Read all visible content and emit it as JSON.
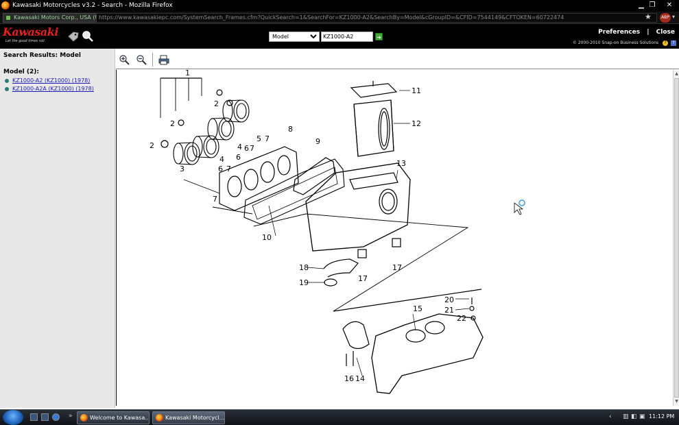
{
  "window": {
    "title": "Kawasaki Motorcycles v3.2 - Search - Mozilla Firefox",
    "minimize": "▁",
    "maximize": "❐",
    "close": "✕"
  },
  "urlbar": {
    "site_identity": "Kawasaki Motors Corp., USA (US)",
    "url": "https://www.kawasakiepc.com/SystemSearch_Frames.cfm?QuickSearch=1&SearchFor=KZ1000-A2&SearchBy=Model&cGroupID=&CFID=7544149&CFTOKEN=60722474",
    "star": "★",
    "addon": "ABP"
  },
  "header": {
    "logo_text": "Kawasaki",
    "logo_tagline": "Let the good times roll.",
    "search_by": "Model",
    "search_options": [
      "Model"
    ],
    "search_value": "KZ1000-A2",
    "go_glyph": "➜",
    "preferences": "Preferences",
    "separator": "|",
    "close": "Close",
    "copyright": "© 2000-2010 Snap-on Business Solutions",
    "help_glyph": "?",
    "info_glyph": "?"
  },
  "sidebar": {
    "heading": "Search Results: Model",
    "group_label": "Model (2):",
    "results": [
      {
        "label": "KZ1000-A2 (KZ1000) (1978)"
      },
      {
        "label": "KZ1000-A2A (KZ1000) (1978)"
      }
    ]
  },
  "toolbar": {
    "zoom_in": "zoom-in",
    "zoom_out": "zoom-out",
    "print": "print"
  },
  "diagram": {
    "callouts": [
      "1",
      "2",
      "2",
      "2",
      "3",
      "4",
      "4",
      "5",
      "6",
      "6",
      "6",
      "7",
      "7",
      "7",
      "7",
      "8",
      "9",
      "10",
      "11",
      "12",
      "13",
      "14",
      "15",
      "16",
      "17",
      "17",
      "18",
      "19",
      "20",
      "21",
      "22"
    ]
  },
  "taskbar": {
    "tasks": [
      {
        "label": "Welcome to Kawasa..."
      },
      {
        "label": "Kawasaki Motorcycl..."
      }
    ],
    "chevron": "»",
    "tray_left": "‹",
    "time": "11:12 PM"
  },
  "colors": {
    "brand_red": "#e2221b",
    "link": "#1a1ab4",
    "go_green": "#3faa35",
    "sidebar_bg": "#e8e8e8"
  }
}
